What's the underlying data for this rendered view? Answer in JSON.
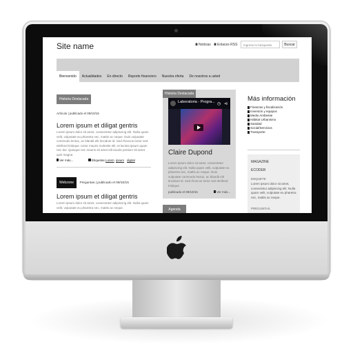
{
  "site": {
    "name": "Site name",
    "links": {
      "noticias": "Noticias",
      "rss": "Enlaces RSS"
    },
    "search": {
      "placeholder": "Ingresa tu búsqueda",
      "button": "Buscar"
    }
  },
  "nav": {
    "items": [
      "Bienvenido",
      "Actualidades",
      "En directo",
      "Reporte financiero",
      "Nuestra oferta",
      "De nosotros a usted"
    ],
    "active": "Bienvenido"
  },
  "col1": {
    "badge": "Historia Destacada",
    "meta1": "Artículo | publicado el 09/10/15",
    "article1": {
      "title": "Lorem ipsum et diligat gentris",
      "text": "Lorem ipsum dolor sit amet, consectetur adipiscing elit. Nulla quam velit, vulputate eu pharetra nec, mattis ac neque. Duis vulputate commodo lectus, ac blandit elit tincidunt id. Sed rhoncus tortor sed eleifend tristique. tortor mauris molestie elit, et lacinia ipsum quam nec dui. Quisque nec mauris sit amet elit iaculis pretium sit amet quis magna"
    },
    "actions": {
      "more": "Ver más...",
      "tags": "Etiquetas :",
      "tag1": "Lorem",
      "tag2": "ipsum",
      "tag3": "digital"
    },
    "webzone": {
      "badge": "Webzone",
      "meta": "Preguntas | publicado el 09/10/15"
    },
    "article2": {
      "title": "Lorem ipsum et diligat gentris",
      "text": "Lorem ipsum dolor sit amet, consectetur adipiscing elit. Nulla quam velit, vulputate eu pharetra nec, mattis ac neque."
    }
  },
  "col2": {
    "badge": "Historia Destacada",
    "video_title": "Laboratoria - Progra...",
    "author": "Claire Dupond",
    "text": "Lorem ipsum dolor sit amet, consectetur adipiscing elit. Nulla quam velit, vulputate eu pharetra nec, mattis ac neque. Duis vulputate commodo lectus, ac blandit elit tincidunt id. Sed rhoncus tortor sed eleifend tristique.",
    "published": "publicado el 09/10/15",
    "more": "Ver más...",
    "agenda": "Agenda"
  },
  "col3": {
    "title": "Más información",
    "categories": [
      "Finanzas y fiscalización",
      "Inversión y equipos",
      "Medio Ambiente",
      "Hábitat Urbanismo",
      "Sanidad",
      "Social/Servicios",
      "Transporte"
    ],
    "box": {
      "magazine": "MAGAZINE",
      "ecoder": "ECODER",
      "enquete": "ENQUETE",
      "text": "Lorem ipsum dolor sit amet, consectetur adipiscing elit. Nulla quam velit, vulputate eu pharetra nec, mattis ac neque.",
      "preguntas": "PREGUNTAS"
    }
  }
}
